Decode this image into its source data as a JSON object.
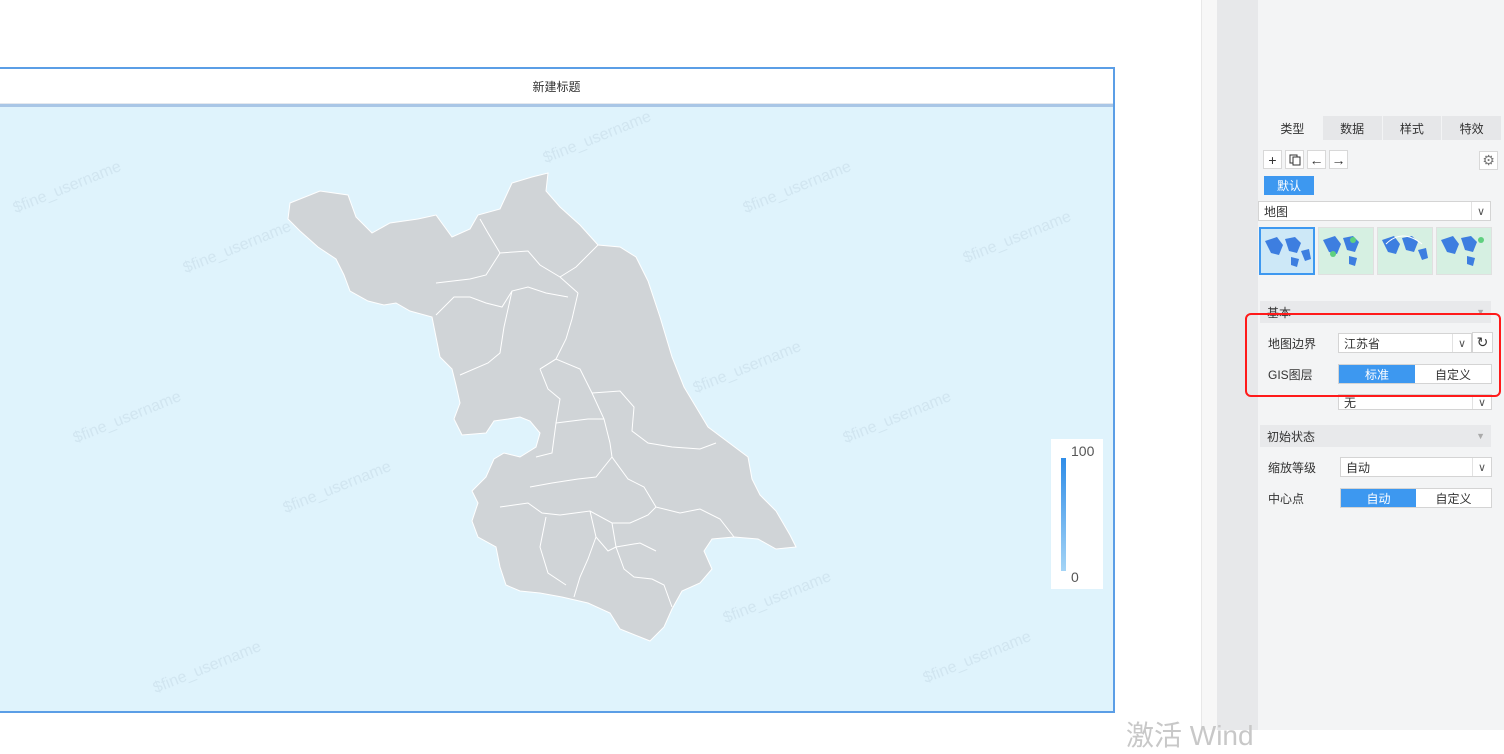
{
  "chart": {
    "title": "新建标题",
    "legend_max": "100",
    "legend_min": "0",
    "watermark": "$fine_username",
    "background_color": "#dff3fc",
    "region_color": "#d0d4d7"
  },
  "panel": {
    "tabs": [
      {
        "label": "类型",
        "active": true
      },
      {
        "label": "数据",
        "active": false
      },
      {
        "label": "样式",
        "active": false
      },
      {
        "label": "特效",
        "active": false
      }
    ],
    "tools": [
      "add-icon",
      "copy-icon",
      "arrow-left-icon",
      "arrow-right-icon"
    ],
    "default_tag": "默认",
    "chart_type": "地图",
    "basic_section": "基本",
    "map_boundary_label": "地图边界",
    "map_boundary_value": "江苏省",
    "gis_layer_label": "GIS图层",
    "gis_options": [
      "标准",
      "自定义"
    ],
    "gis_selected": "标准",
    "layer_value": "无",
    "initial_state_section": "初始状态",
    "zoom_label": "缩放等级",
    "zoom_value": "自动",
    "center_label": "中心点",
    "center_options": [
      "自动",
      "自定义"
    ],
    "center_selected": "自动",
    "accent_color": "#3d98f0"
  },
  "os": {
    "activate_text": "激活 Wind"
  }
}
